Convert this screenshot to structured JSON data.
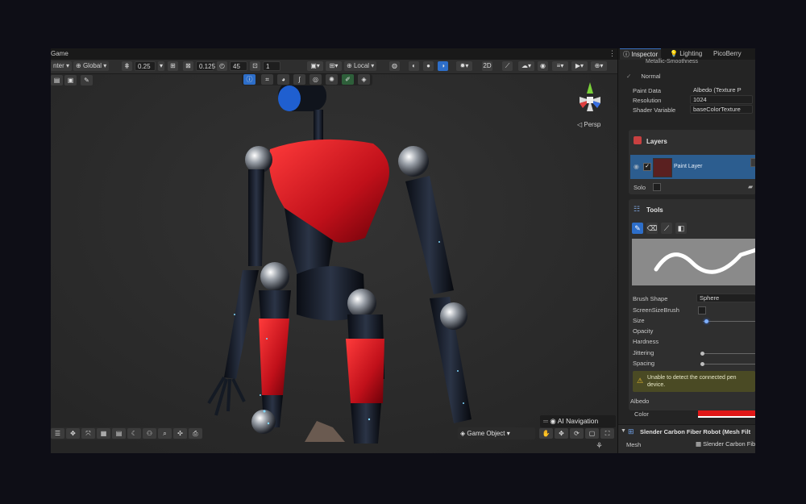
{
  "scene": {
    "tab_label": "Game",
    "more_menu": "⋮",
    "toolbar": {
      "pivot_label": "nter",
      "global_label": "Global",
      "move_snap": "0.25",
      "scale_snap": "0.125",
      "rotate_snap": "45",
      "grid_size": "1",
      "local_label": "Local"
    },
    "persp_label": "Persp",
    "ai_nav_label": "AI Navigation",
    "game_object_label": "Game Object"
  },
  "inspector": {
    "tabs": {
      "inspector": "Inspector",
      "lighting": "Lighting",
      "picoberry": "PicoBerry"
    },
    "top_rows": {
      "metallic": "Metallic-Smoothness",
      "normal": "Normal"
    },
    "props": [
      {
        "label": "Paint Data",
        "value": "Albedo (Texture P"
      },
      {
        "label": "Resolution",
        "value": "1024"
      },
      {
        "label": "Shader Variable",
        "value": "baseColorTexture"
      }
    ],
    "layers": {
      "title": "Layers",
      "layer_name": "Paint Layer",
      "solo_label": "Solo"
    },
    "tools": {
      "title": "Tools",
      "brush_shape_label": "Brush Shape",
      "brush_shape_value": "Sphere",
      "screen_size_brush_label": "ScreenSizeBrush",
      "size_label": "Size",
      "opacity_label": "Opacity",
      "hardness_label": "Hardness",
      "jittering_label": "Jittering",
      "spacing_label": "Spacing",
      "warning_text": "Unable to detect the connected pen device.",
      "albedo_label": "Albedo",
      "color_label": "Color",
      "color_value": "#e01818"
    },
    "component": {
      "title": "Slender Carbon Fiber Robot (Mesh Filt",
      "mesh_label": "Mesh",
      "mesh_value": "Slender Carbon Fib"
    }
  },
  "colors": {
    "accent_blue": "#2d6ec9",
    "layer_selected": "#2c5d8f",
    "robot_red": "#c8141a"
  }
}
